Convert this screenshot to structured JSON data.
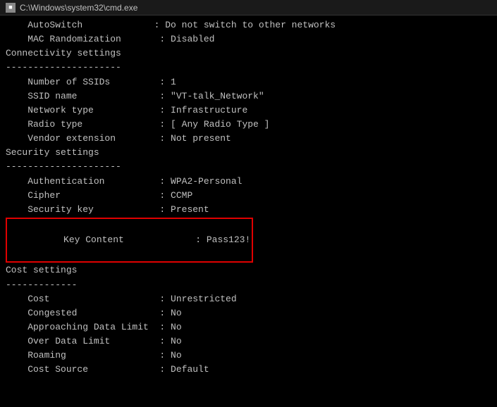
{
  "titlebar": {
    "icon": "■",
    "title": "C:\\Windows\\system32\\cmd.exe"
  },
  "lines": [
    {
      "id": "autoswitch",
      "text": "    AutoSwitch             : Do not switch to other networks"
    },
    {
      "id": "mac-random",
      "text": "    MAC Randomization       : Disabled"
    },
    {
      "id": "blank1",
      "text": ""
    },
    {
      "id": "connectivity-hdr",
      "text": "Connectivity settings"
    },
    {
      "id": "conn-div",
      "text": "---------------------"
    },
    {
      "id": "num-ssids",
      "text": "    Number of SSIDs         : 1"
    },
    {
      "id": "ssid-name",
      "text": "    SSID name               : \"VT-talk_Network\""
    },
    {
      "id": "network-type",
      "text": "    Network type            : Infrastructure"
    },
    {
      "id": "radio-type",
      "text": "    Radio type              : [ Any Radio Type ]"
    },
    {
      "id": "vendor-ext",
      "text": "    Vendor extension        : Not present"
    },
    {
      "id": "blank2",
      "text": ""
    },
    {
      "id": "security-hdr",
      "text": "Security settings"
    },
    {
      "id": "sec-div",
      "text": "---------------------"
    },
    {
      "id": "authentication",
      "text": "    Authentication          : WPA2-Personal"
    },
    {
      "id": "cipher",
      "text": "    Cipher                  : CCMP"
    },
    {
      "id": "security-key",
      "text": "    Security key            : Present"
    },
    {
      "id": "blank3",
      "text": ""
    },
    {
      "id": "blank4",
      "text": ""
    },
    {
      "id": "cost-hdr",
      "text": "Cost settings"
    },
    {
      "id": "cost-div",
      "text": "-------------"
    },
    {
      "id": "cost",
      "text": "    Cost                    : Unrestricted"
    },
    {
      "id": "congested",
      "text": "    Congested               : No"
    },
    {
      "id": "approaching",
      "text": "    Approaching Data Limit  : No"
    },
    {
      "id": "over-data",
      "text": "    Over Data Limit         : No"
    },
    {
      "id": "roaming",
      "text": "    Roaming                 : No"
    },
    {
      "id": "cost-source",
      "text": "    Cost Source             : Default"
    }
  ],
  "key_content": {
    "label": "    Key Content             ",
    "value": ": Pass123!"
  }
}
